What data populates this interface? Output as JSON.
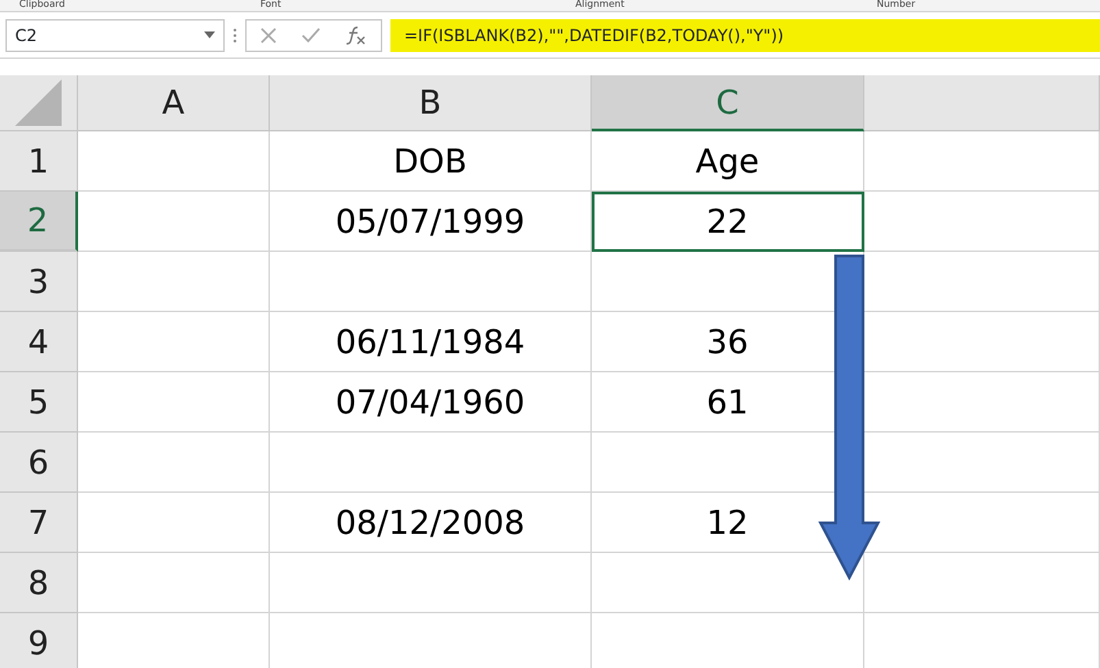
{
  "ribbon_groups": [
    "Clipboard",
    "Font",
    "Alignment",
    "Number"
  ],
  "name_box": {
    "value": "C2"
  },
  "formula_bar": {
    "formula": "=IF(ISBLANK(B2),\"\",DATEDIF(B2,TODAY(),\"Y\"))",
    "highlighted": true
  },
  "columns": [
    {
      "label": "A",
      "selected": false
    },
    {
      "label": "B",
      "selected": false
    },
    {
      "label": "C",
      "selected": true
    }
  ],
  "rows": [
    {
      "label": "1",
      "selected": false,
      "cells": [
        {
          "text": "",
          "selected": false
        },
        {
          "text": "DOB",
          "selected": false
        },
        {
          "text": "Age",
          "selected": false
        }
      ]
    },
    {
      "label": "2",
      "selected": true,
      "cells": [
        {
          "text": "",
          "selected": false
        },
        {
          "text": "05/07/1999",
          "selected": false
        },
        {
          "text": "22",
          "selected": true
        }
      ]
    },
    {
      "label": "3",
      "selected": false,
      "cells": [
        {
          "text": "",
          "selected": false
        },
        {
          "text": "",
          "selected": false
        },
        {
          "text": "",
          "selected": false
        }
      ]
    },
    {
      "label": "4",
      "selected": false,
      "cells": [
        {
          "text": "",
          "selected": false
        },
        {
          "text": "06/11/1984",
          "selected": false
        },
        {
          "text": "36",
          "selected": false
        }
      ]
    },
    {
      "label": "5",
      "selected": false,
      "cells": [
        {
          "text": "",
          "selected": false
        },
        {
          "text": "07/04/1960",
          "selected": false
        },
        {
          "text": "61",
          "selected": false
        }
      ]
    },
    {
      "label": "6",
      "selected": false,
      "cells": [
        {
          "text": "",
          "selected": false
        },
        {
          "text": "",
          "selected": false
        },
        {
          "text": "",
          "selected": false
        }
      ]
    },
    {
      "label": "7",
      "selected": false,
      "cells": [
        {
          "text": "",
          "selected": false
        },
        {
          "text": "08/12/2008",
          "selected": false
        },
        {
          "text": "12",
          "selected": false
        }
      ]
    },
    {
      "label": "8",
      "selected": false,
      "cells": [
        {
          "text": "",
          "selected": false
        },
        {
          "text": "",
          "selected": false
        },
        {
          "text": "",
          "selected": false
        }
      ]
    },
    {
      "label": "9",
      "selected": false,
      "cells": [
        {
          "text": "",
          "selected": false
        },
        {
          "text": "",
          "selected": false
        },
        {
          "text": "",
          "selected": false
        }
      ]
    }
  ]
}
